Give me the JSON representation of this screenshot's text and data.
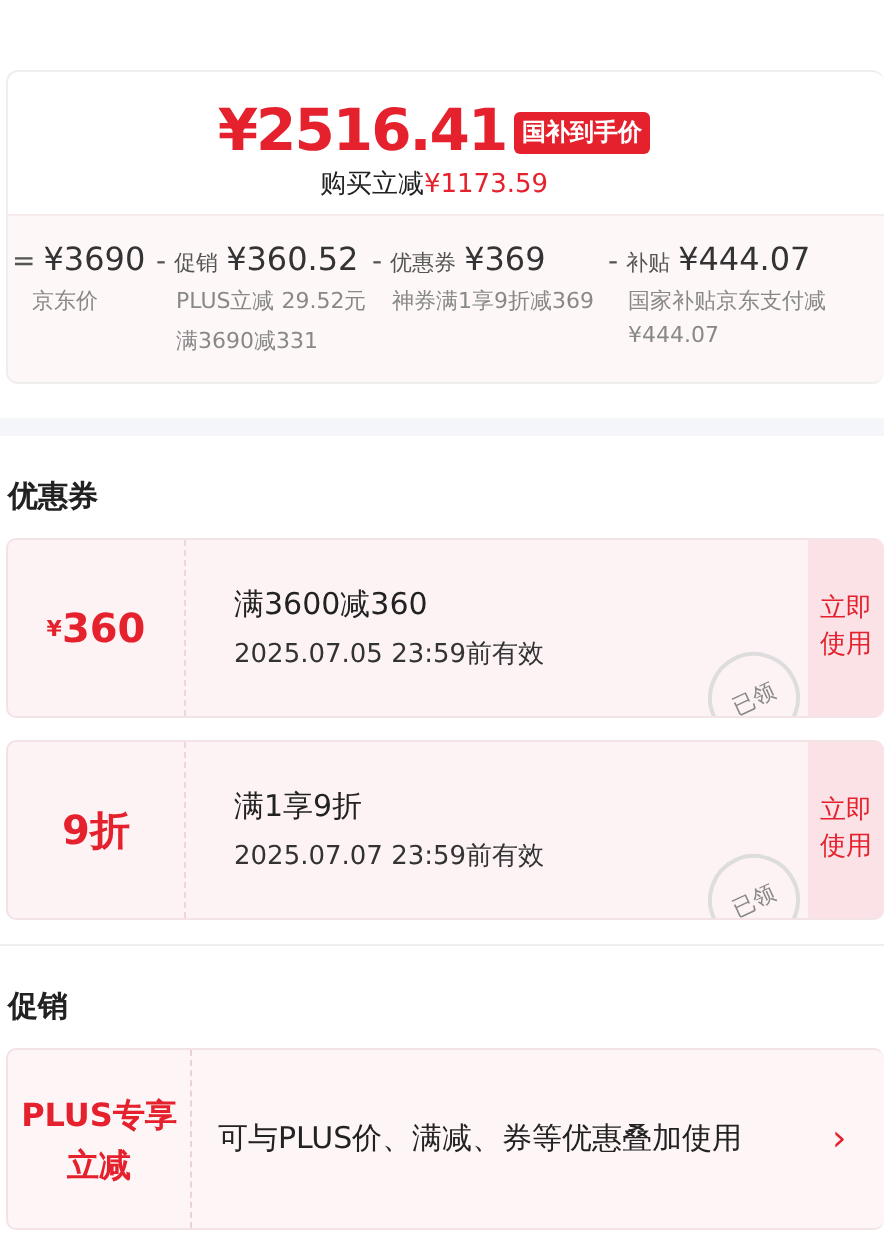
{
  "price_card": {
    "final_price": "¥2516.41",
    "badge": "国补到手价",
    "saving_label": "购买立减",
    "saving_amount": "¥1173.59",
    "breakdown": [
      {
        "operator": "=",
        "amount": "¥3690",
        "notes": [
          "京东价"
        ]
      },
      {
        "operator": "-",
        "label": "促销",
        "amount": "¥360.52",
        "notes": [
          "PLUS立减 29.52元",
          "满3690减331"
        ]
      },
      {
        "operator": "-",
        "label": "优惠券",
        "amount": "¥369",
        "notes": [
          "神券满1享9折减369"
        ]
      },
      {
        "operator": "-",
        "label": "补贴",
        "amount": "¥444.07",
        "notes": [
          "国家补贴京东支付减¥444.07"
        ]
      }
    ]
  },
  "coupons_section": {
    "title": "优惠券",
    "coupons": [
      {
        "currency": "¥",
        "value": "360",
        "condition": "满3600减360",
        "validity": "2025.07.05 23:59前有效",
        "stamp": "已领",
        "action": "立即使用"
      },
      {
        "value": "9折",
        "condition": "满1享9折",
        "validity": "2025.07.07 23:59前有效",
        "stamp": "已领",
        "action": "立即使用"
      }
    ]
  },
  "promotions_section": {
    "title": "促销",
    "promotions": [
      {
        "tag": "PLUS专享立减",
        "description": "可与PLUS价、满减、券等优惠叠加使用",
        "chevron": "›"
      }
    ]
  }
}
